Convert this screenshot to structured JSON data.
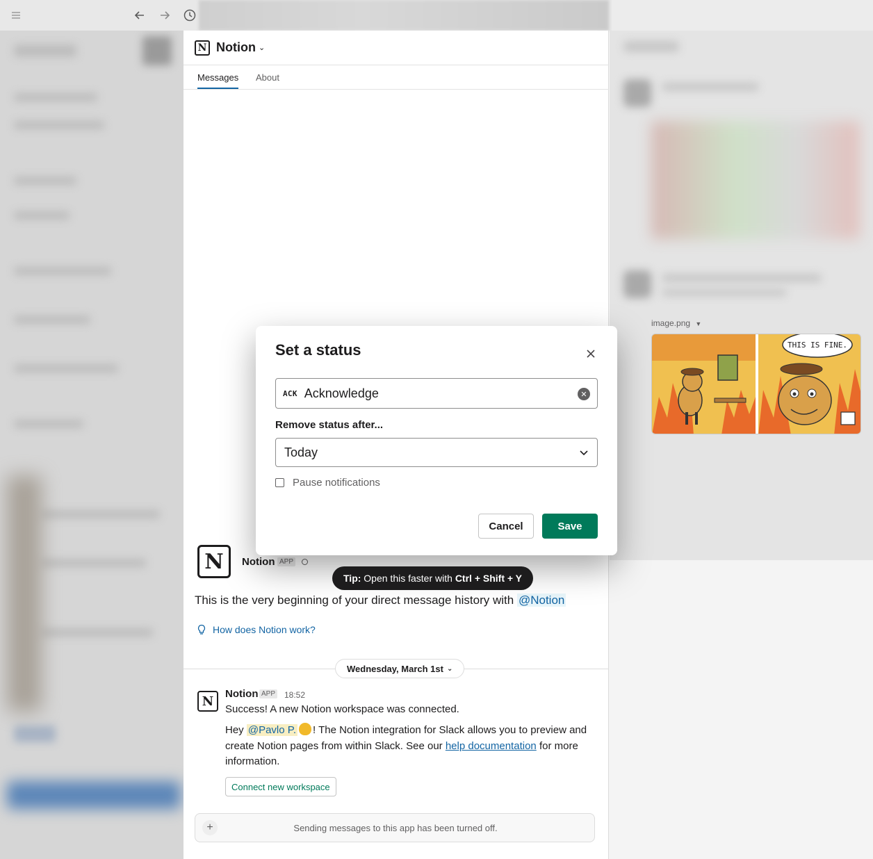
{
  "window": {
    "icons": [
      "menu-icon",
      "back-arrow-icon",
      "forward-arrow-icon",
      "history-clock-icon"
    ]
  },
  "channel": {
    "title": "Notion",
    "tabs": [
      {
        "label": "Messages",
        "active": true
      },
      {
        "label": "About",
        "active": false
      }
    ]
  },
  "intro": {
    "name": "Notion",
    "badge": "APP",
    "text": "This is the very beginning of your direct message history with",
    "mention": "@Notion",
    "how_link": "How does Notion work?"
  },
  "date_divider": "Wednesday, March 1st",
  "message": {
    "sender": "Notion",
    "badge": "APP",
    "time": "18:52",
    "line1": "Success! A new Notion workspace was connected.",
    "para_prefix": "Hey",
    "user_mention": "@Pavlo P.",
    "para_mid": "! The Notion integration for Slack allows you to preview and create Notion pages from within Slack. See our",
    "link_text": "help documentation",
    "para_suffix": "for more information.",
    "button": "Connect new workspace"
  },
  "composer": {
    "text": "Sending messages to this app has been turned off."
  },
  "right_pane": {
    "image_label": "image.png",
    "comic_text": "THIS IS FINE."
  },
  "modal": {
    "title": "Set a status",
    "emoji_text": "ACK",
    "status_value": "Acknowledge",
    "remove_label": "Remove status after...",
    "remove_value": "Today",
    "pause_label": "Pause notifications",
    "pause_checked": false,
    "cancel": "Cancel",
    "save": "Save"
  },
  "tip": {
    "prefix": "Tip:",
    "text": "Open this faster with",
    "keys": "Ctrl + Shift + Y"
  },
  "colors": {
    "accent_green": "#007a5a",
    "link_blue": "#1264a3",
    "tip_bg": "#1d1c1d"
  }
}
